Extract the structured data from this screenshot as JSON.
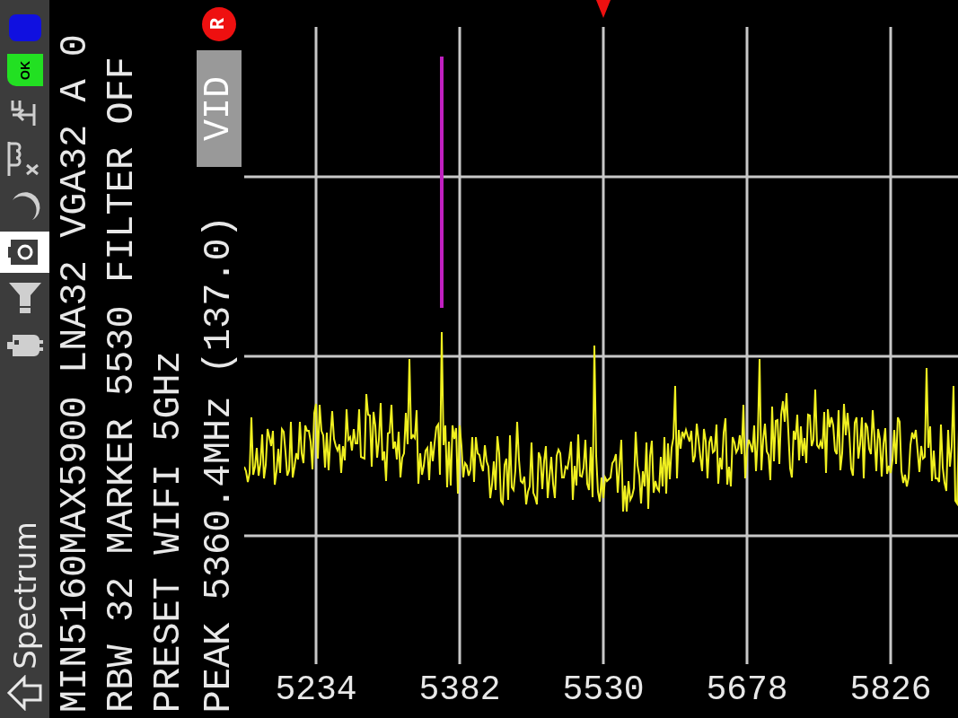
{
  "sidebar": {
    "title": "Spectrum",
    "tools": [
      {
        "kind": "blue-block",
        "selected": false
      },
      {
        "kind": "ok-badge",
        "label": "OK",
        "selected": false
      },
      {
        "kind": "signal-in",
        "selected": false
      },
      {
        "kind": "coil",
        "selected": false
      },
      {
        "kind": "moon",
        "selected": false
      },
      {
        "kind": "camera",
        "selected": true
      },
      {
        "kind": "funnel",
        "selected": false
      },
      {
        "kind": "robot",
        "selected": false
      }
    ]
  },
  "status_lines": [
    "MIN5160MAX5900 LNA32 VGA32 A 0",
    "RBW 32 MARKER 5530 FILTER OFF",
    "PRESET WIFI 5GHz",
    "PEAK 5360.4MHz (137.0)"
  ],
  "record_badge": {
    "label": "R"
  },
  "vid_button": {
    "label": "VID"
  },
  "chart": {
    "x_labels": [
      "5234",
      "5382",
      "5530",
      "5678",
      "5826"
    ]
  }
}
